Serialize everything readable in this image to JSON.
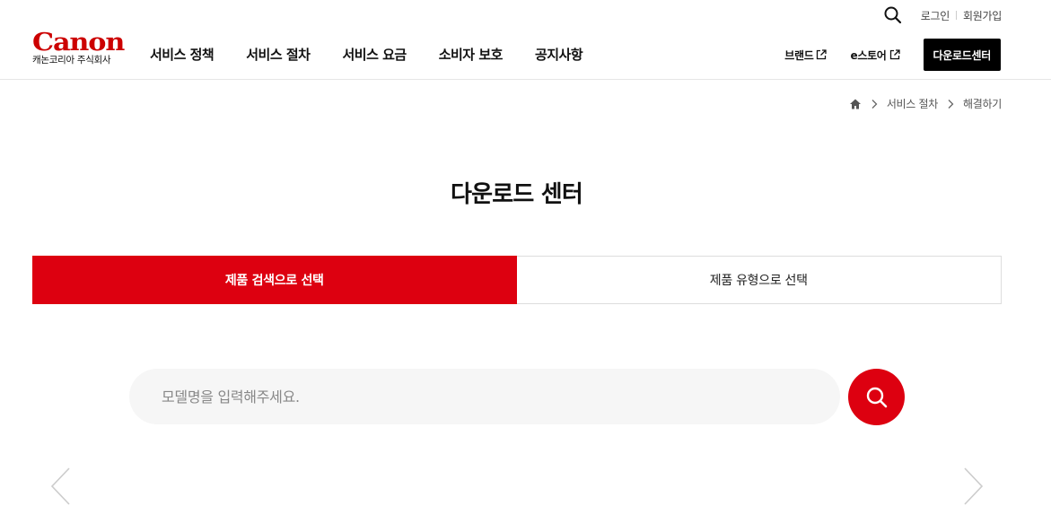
{
  "logo": {
    "word": "Canon",
    "sub": "캐논코리아 주식회사"
  },
  "utility": {
    "login": "로그인",
    "signup": "회원가입"
  },
  "gnb": [
    {
      "label": "서비스 정책"
    },
    {
      "label": "서비스 절차"
    },
    {
      "label": "서비스 요금"
    },
    {
      "label": "소비자 보호"
    },
    {
      "label": "공지사항"
    }
  ],
  "right_nav": {
    "brand": "브랜드",
    "estore": "e스토어",
    "download_center": "다운로드센터"
  },
  "breadcrumb": {
    "items": [
      "서비스 절차",
      "해결하기"
    ]
  },
  "page": {
    "title": "다운로드 센터"
  },
  "tabs": [
    {
      "label": "제품 검색으로 선택",
      "active": true
    },
    {
      "label": "제품 유형으로 선택",
      "active": false
    }
  ],
  "search": {
    "placeholder": "모델명을 입력해주세요.",
    "value": ""
  },
  "colors": {
    "accent": "#dd0010",
    "brand_logo": "#cc0000",
    "dark_button": "#000000"
  },
  "icons": {
    "utility_search": "search-icon",
    "external": "external-link-icon",
    "home": "home-icon",
    "breadcrumb_separator": "chevron-right-icon",
    "search_button": "search-icon",
    "carousel_prev": "chevron-left-icon",
    "carousel_next": "chevron-right-icon"
  }
}
